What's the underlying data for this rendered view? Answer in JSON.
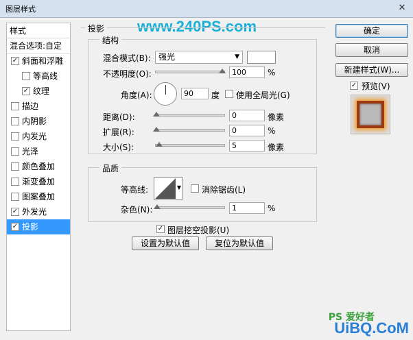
{
  "window": {
    "title": "图层样式",
    "close_glyph": "✕"
  },
  "watermark": "www.240PS.com",
  "left_panel": {
    "header": "样式",
    "blend_options": "混合选项:自定",
    "items": [
      {
        "label": "斜面和浮雕",
        "checked": true,
        "indent": false
      },
      {
        "label": "等高线",
        "checked": false,
        "indent": true
      },
      {
        "label": "纹理",
        "checked": true,
        "indent": true
      },
      {
        "label": "描边",
        "checked": false,
        "indent": false
      },
      {
        "label": "内阴影",
        "checked": false,
        "indent": false
      },
      {
        "label": "内发光",
        "checked": false,
        "indent": false
      },
      {
        "label": "光泽",
        "checked": false,
        "indent": false
      },
      {
        "label": "颜色叠加",
        "checked": false,
        "indent": false
      },
      {
        "label": "渐变叠加",
        "checked": false,
        "indent": false
      },
      {
        "label": "图案叠加",
        "checked": false,
        "indent": false
      },
      {
        "label": "外发光",
        "checked": true,
        "indent": false
      },
      {
        "label": "投影",
        "checked": true,
        "indent": false,
        "selected": true
      }
    ]
  },
  "drop_shadow": {
    "section_title": "投影",
    "structure": {
      "title": "结构",
      "blend_mode_label": "混合模式(B):",
      "blend_mode_value": "强光",
      "opacity_label": "不透明度(O):",
      "opacity_value": "100",
      "opacity_unit": "%",
      "angle_label": "角度(A):",
      "angle_value": "90",
      "angle_unit": "度",
      "global_light_label": "使用全局光(G)",
      "distance_label": "距离(D):",
      "distance_value": "0",
      "distance_unit": "像素",
      "spread_label": "扩展(R):",
      "spread_value": "0",
      "spread_unit": "%",
      "size_label": "大小(S):",
      "size_value": "5",
      "size_unit": "像素"
    },
    "quality": {
      "title": "品质",
      "contour_label": "等高线:",
      "antialias_label": "消除锯齿(L)",
      "noise_label": "杂色(N):",
      "noise_value": "1",
      "noise_unit": "%"
    },
    "knockout_label": "图层挖空投影(U)",
    "make_default": "设置为默认值",
    "reset_default": "复位为默认值"
  },
  "buttons": {
    "ok": "确定",
    "cancel": "取消",
    "new_style": "新建样式(W)...",
    "preview_label": "预览(V)"
  },
  "checkmark": "✓",
  "footer_logo": "UiBQ.CoM",
  "footer_logo_cn": "PS 爱好者"
}
